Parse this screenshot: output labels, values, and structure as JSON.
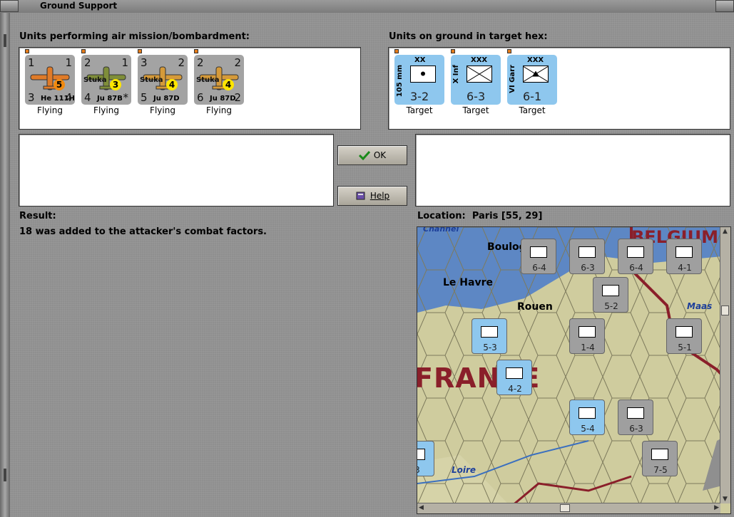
{
  "window": {
    "title": "Ground Support"
  },
  "left_label": "Units performing air mission/bombardment:",
  "right_label": "Units on ground in target hex:",
  "air_units": [
    {
      "top_left": "1",
      "top_right": "1",
      "bottom_left": "3",
      "bottom_right": "4",
      "aircraft": "He 111H",
      "extra_label": "",
      "badge": "5",
      "badge_color": "#f08a10",
      "camo": "orange",
      "status": "Flying"
    },
    {
      "top_left": "2",
      "top_right": "1",
      "bottom_left": "4",
      "bottom_right": "*",
      "aircraft": "Ju 87B",
      "extra_label": "Stuka",
      "badge": "3",
      "badge_color": "#ffe600",
      "camo": "green",
      "status": "Flying"
    },
    {
      "top_left": "3",
      "top_right": "2",
      "bottom_left": "5",
      "bottom_right": "",
      "aircraft": "Ju 87D",
      "extra_label": "Stuka",
      "badge": "4",
      "badge_color": "#ffe600",
      "camo": "tan",
      "status": "Flying"
    },
    {
      "top_left": "2",
      "top_right": "2",
      "bottom_left": "6",
      "bottom_right": "2",
      "aircraft": "Ju 87D",
      "extra_label": "Stuka",
      "badge": "4",
      "badge_color": "#ffe600",
      "camo": "tan",
      "status": "Flying"
    }
  ],
  "ground_units": [
    {
      "size": "XX",
      "side_label": "105 mm",
      "symbol": "artillery",
      "strength": "3-2",
      "status": "Target"
    },
    {
      "size": "XXX",
      "side_label": "X Inf",
      "symbol": "infantry",
      "strength": "6-3",
      "status": "Target"
    },
    {
      "size": "XXX",
      "side_label": "VI Garr",
      "symbol": "garrison",
      "strength": "6-1",
      "status": "Target"
    }
  ],
  "buttons": {
    "ok": "OK",
    "help": "Help"
  },
  "result": {
    "label": "Result:",
    "text": "18 was added to the attacker's combat factors."
  },
  "location": {
    "label": "Location:",
    "value": "Paris  [55, 29]"
  },
  "map": {
    "places": [
      "Boulogne",
      "Le Havre",
      "Rouen",
      "Maas",
      "Loire",
      "Channel"
    ],
    "regions": [
      "FRANCE",
      "BELGIUM"
    ],
    "counters": [
      "6-4",
      "6-3",
      "6-4",
      "4-1",
      "5-2",
      "5-3",
      "1-4",
      "5-1",
      "4-2",
      "5-4",
      "6-3",
      "7-5",
      "3"
    ]
  }
}
